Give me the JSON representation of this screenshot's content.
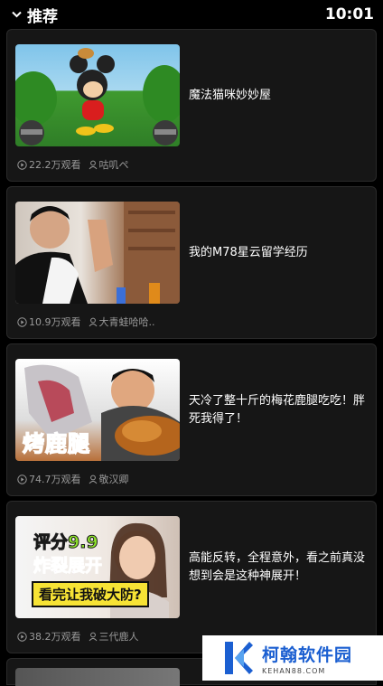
{
  "header": {
    "title": "推荐",
    "time": "10:01"
  },
  "feed": [
    {
      "title": "魔法猫咪妙妙屋",
      "views": "22.2万观看",
      "author": "咕叽ペ"
    },
    {
      "title": "我的M78星云留学经历",
      "views": "10.9万观看",
      "author": "大青蛙哈哈.."
    },
    {
      "title": "天冷了整十斤的梅花鹿腿吃吃！胖死我得了！",
      "views": "74.7万观看",
      "author": "敬汉卿",
      "thumb_caption": "烤鹿腿"
    },
    {
      "title": "高能反转，全程意外，看之前真没想到会是这种神展开！",
      "views": "38.2万观看",
      "author": "三代鹿人",
      "thumb_lines": [
        "评分9.9",
        "炸裂展开",
        "看完让我破大防?"
      ]
    }
  ],
  "watermark": {
    "name": "柯翰软件园",
    "url": "KEHAN88.COM"
  },
  "colors": {
    "background": "#000000",
    "card": "#161616",
    "meta": "#9a9a9a",
    "watermark_blue": "#1b5fd1"
  }
}
